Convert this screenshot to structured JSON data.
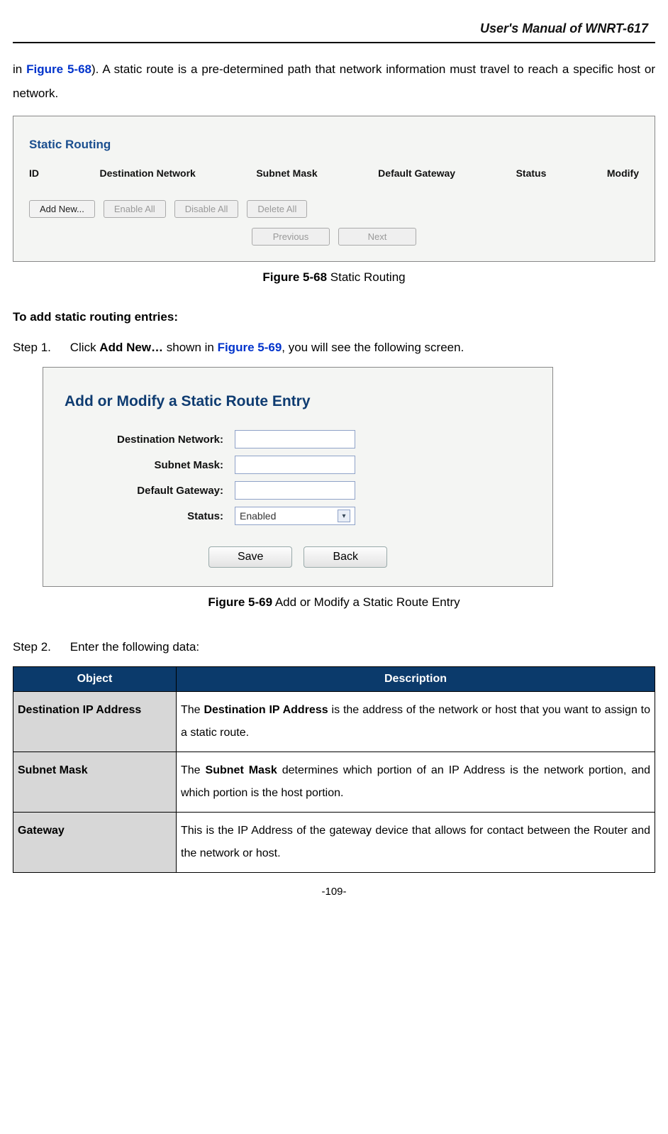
{
  "header": {
    "doc_title": "User's  Manual  of  WNRT-617"
  },
  "intro": {
    "prefix": "in ",
    "figref": "Figure 5-68",
    "rest": "). A static route is a pre-determined path that network information must travel to reach a specific host or network."
  },
  "figure1": {
    "panel_title": "Static Routing",
    "columns": [
      "ID",
      "Destination Network",
      "Subnet Mask",
      "Default Gateway",
      "Status",
      "Modify"
    ],
    "buttons_row1": [
      "Add New...",
      "Enable All",
      "Disable All",
      "Delete All"
    ],
    "buttons_row2": [
      "Previous",
      "Next"
    ],
    "caption_bold": "Figure 5-68",
    "caption_rest": "    Static Routing"
  },
  "addentries_head": "To add static routing entries:",
  "step1": {
    "label": "Step 1.",
    "before": "Click ",
    "bold1": "Add New…",
    "mid": " shown in ",
    "link": "Figure 5-69",
    "after": ", you will see the following screen."
  },
  "figure2": {
    "panel_title": "Add or Modify a Static Route Entry",
    "labels": {
      "dest": "Destination Network:",
      "mask": "Subnet Mask:",
      "gw": "Default Gateway:",
      "status": "Status:"
    },
    "status_value": "Enabled",
    "btn_save": "Save",
    "btn_back": "Back",
    "caption_bold": "Figure 5-69",
    "caption_rest": "    Add or Modify a Static Route Entry"
  },
  "step2": {
    "label": "Step 2.",
    "text": "Enter the following data:"
  },
  "table": {
    "head_obj": "Object",
    "head_desc": "Description",
    "rows": [
      {
        "obj": "Destination IP Address",
        "desc_pre": "The ",
        "desc_bold": "Destination IP Address",
        "desc_post": " is the address of the network or host that you want to assign to a static route."
      },
      {
        "obj": "Subnet Mask",
        "desc_pre": "The ",
        "desc_bold": "Subnet Mask",
        "desc_post": " determines which portion of an IP Address is the network portion, and which portion is the host portion."
      },
      {
        "obj": "Gateway",
        "desc_pre": "",
        "desc_bold": "",
        "desc_post": "This is the IP Address of the gateway device that allows for contact between the Router and the network or host."
      }
    ]
  },
  "footer": {
    "page": "-109-"
  }
}
